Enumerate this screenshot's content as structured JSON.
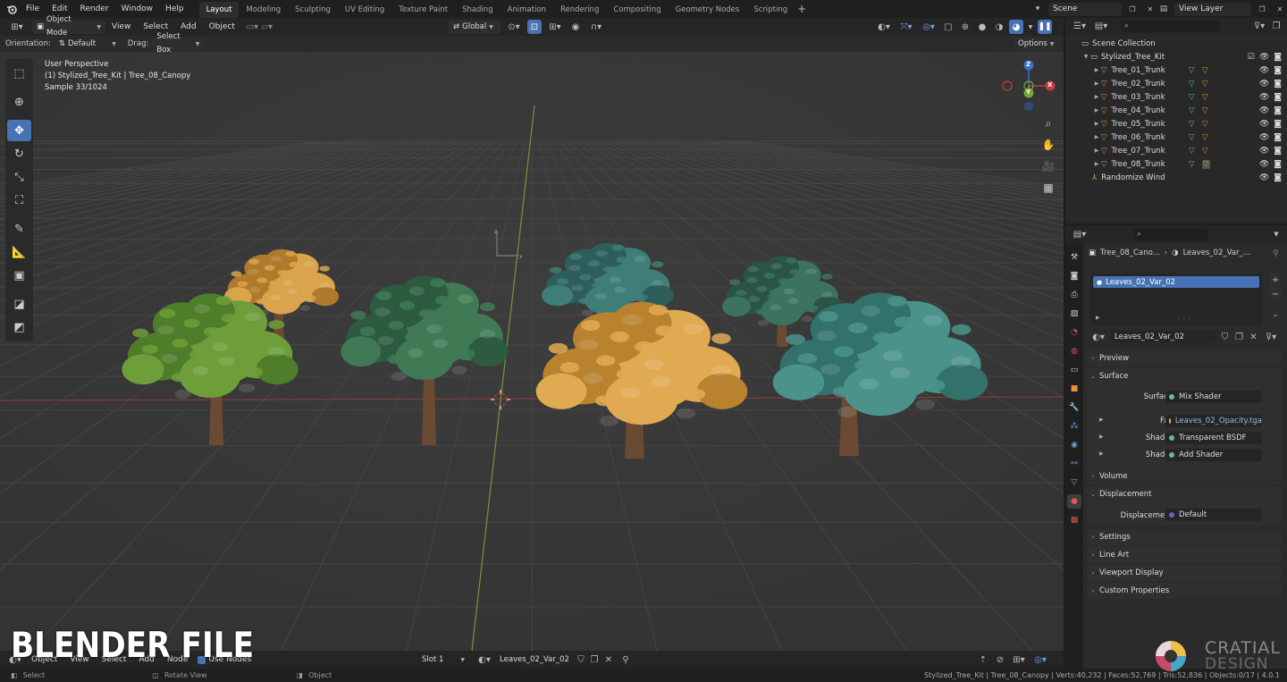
{
  "topbar": {
    "menus": [
      "File",
      "Edit",
      "Render",
      "Window",
      "Help"
    ],
    "workspaces": [
      "Layout",
      "Modeling",
      "Sculpting",
      "UV Editing",
      "Texture Paint",
      "Shading",
      "Animation",
      "Rendering",
      "Compositing",
      "Geometry Nodes",
      "Scripting"
    ],
    "active_workspace": "Layout",
    "scene": "Scene",
    "view_layer": "View Layer"
  },
  "header": {
    "mode": "Object Mode",
    "menus": [
      "View",
      "Select",
      "Add",
      "Object"
    ],
    "transform_orientation": "Global",
    "options": "Options"
  },
  "header2": {
    "orientation_label": "Orientation:",
    "orientation_value": "Default",
    "drag_label": "Drag:",
    "drag_value": "Select Box"
  },
  "viewport": {
    "info_line1": "User Perspective",
    "info_line2": "(1) Stylized_Tree_Kit | Tree_08_Canopy",
    "info_line3": "Sample 33/1024",
    "gizmo_axes": [
      "Z",
      "Y",
      "X"
    ],
    "colors": {
      "bg": "#393939",
      "x_axis": "#b53c3c",
      "y_axis": "#7ba33a",
      "z_axis": "#3a6fc4"
    }
  },
  "trees": [
    {
      "canopy": "#6e9e3a",
      "canopy2": "#4e7e2a",
      "trunk": "#6b4a34"
    },
    {
      "canopy": "#d9a44c",
      "canopy2": "#b07a2c",
      "trunk": "#6b4a34"
    },
    {
      "canopy": "#3f7a55",
      "canopy2": "#2c5b40",
      "trunk": "#6b4a34"
    },
    {
      "canopy": "#3f7d78",
      "canopy2": "#2d5e5a",
      "trunk": "#6b4a34"
    },
    {
      "canopy": "#e0aa52",
      "canopy2": "#b8822f",
      "trunk": "#6b4a34"
    },
    {
      "canopy": "#3c7260",
      "canopy2": "#2a5546",
      "trunk": "#6b4a34"
    },
    {
      "canopy": "#4b938a",
      "canopy2": "#33726a",
      "trunk": "#6b4a34"
    }
  ],
  "outliner": {
    "root": "Scene Collection",
    "collection": "Stylized_Tree_Kit",
    "items": [
      "Tree_01_Trunk",
      "Tree_02_Trunk",
      "Tree_03_Trunk",
      "Tree_04_Trunk",
      "Tree_05_Trunk",
      "Tree_06_Trunk",
      "Tree_07_Trunk",
      "Tree_08_Trunk"
    ],
    "extra": "Randomize Wind"
  },
  "properties": {
    "breadcrumb_object": "Tree_08_Cano...",
    "breadcrumb_material": "Leaves_02_Var_...",
    "slot_name": "Leaves_02_Var_02",
    "material_name": "Leaves_02_Var_02",
    "panels": {
      "preview": "Preview",
      "surface": "Surface",
      "volume": "Volume",
      "displacement": "Displacement",
      "settings": "Settings",
      "line_art": "Line Art",
      "viewport_display": "Viewport Display",
      "custom_properties": "Custom Properties"
    },
    "surface_label": "Surface",
    "surface_value": "Mix Shader",
    "fac_label": "Fac",
    "fac_value": "Leaves_02_Opacity.tga",
    "shader1_label": "Shader",
    "shader1_value": "Transparent BSDF",
    "shader2_label": "Shader",
    "shader2_value": "Add Shader",
    "displacement_label": "Displacement",
    "displacement_value": "Default"
  },
  "footer": {
    "left_items": [
      "Object",
      "View",
      "Select",
      "Add",
      "Node",
      "Use Nodes"
    ],
    "slot": "Slot 1",
    "material": "Leaves_02_Var_02"
  },
  "statusbar": {
    "select": "Select",
    "rotate": "Rotate View",
    "object": "Object",
    "stats": "Stylized_Tree_Kit | Tree_08_Canopy | Verts:40,232 | Faces:52,769 | Tris:52,836 | Objects:0/17 | 4.0.1"
  },
  "watermark": "BLENDER FILE",
  "logo": {
    "line1": "CRATIAL",
    "line2": "DESIGN"
  }
}
